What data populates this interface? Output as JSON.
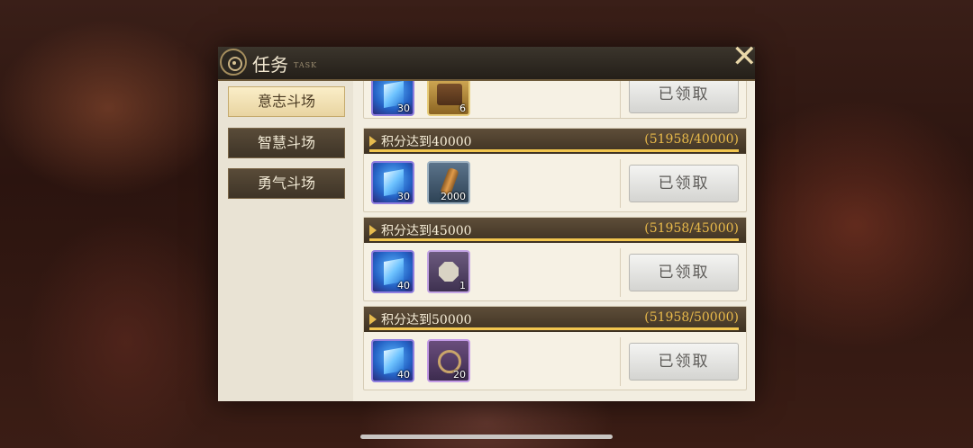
{
  "title": {
    "text": "任务",
    "sub": "TASK"
  },
  "close_icon": "close-icon",
  "tabs": [
    {
      "label": "意志斗场",
      "active": true
    },
    {
      "label": "智慧斗场",
      "active": false
    },
    {
      "label": "勇气斗场",
      "active": false
    }
  ],
  "tasks": [
    {
      "name": "",
      "progress": "",
      "items": [
        {
          "icon": "crystal",
          "qty": "30"
        },
        {
          "icon": "chest",
          "qty": "6"
        }
      ],
      "button": "已领取"
    },
    {
      "name": "积分达到40000",
      "progress": "(51958/40000)",
      "items": [
        {
          "icon": "crystal",
          "qty": "30"
        },
        {
          "icon": "bottle",
          "qty": "2000"
        }
      ],
      "button": "已领取"
    },
    {
      "name": "积分达到45000",
      "progress": "(51958/45000)",
      "items": [
        {
          "icon": "crystal",
          "qty": "40"
        },
        {
          "icon": "seal",
          "qty": "1"
        }
      ],
      "button": "已领取"
    },
    {
      "name": "积分达到50000",
      "progress": "(51958/50000)",
      "items": [
        {
          "icon": "crystal",
          "qty": "40"
        },
        {
          "icon": "wheel",
          "qty": "20"
        }
      ],
      "button": "已领取"
    }
  ],
  "colors": {
    "accent": "#e8b94a",
    "bar_fill": "#f2c64f",
    "header": "#3e3222"
  },
  "progress_fill": 1.0
}
